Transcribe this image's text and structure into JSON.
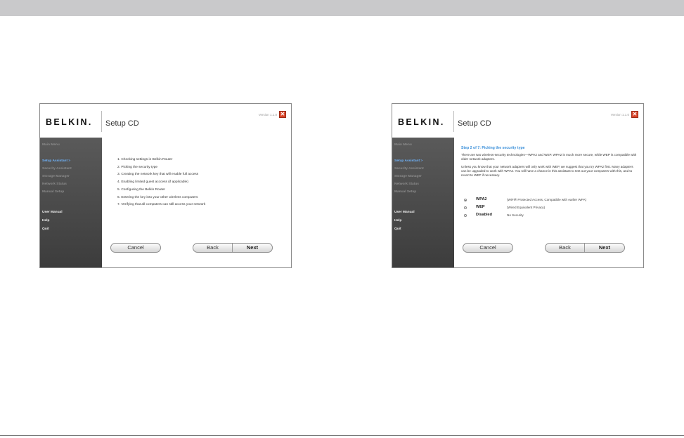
{
  "common": {
    "brand": "BELKIN.",
    "title": "Setup CD",
    "version": "Version 1.1.0",
    "close_symbol": "✕",
    "buttons": {
      "cancel": "Cancel",
      "back": "Back",
      "next": "Next"
    },
    "sidebar": {
      "main_menu": "Main Menu",
      "setup_assistant": "Setup Assistant  >",
      "security_assistant": "Security Assistant",
      "storage_manager": "Storage Manager",
      "network_status": "Network Status",
      "manual_setup": "Manual Setup",
      "user_manual": "User Manual",
      "help": "Help",
      "quit": "Quit"
    }
  },
  "left_window": {
    "steps": [
      "1. Checking settings in Belkin Router",
      "2. Picking the security type",
      "3. Creating the network key that will enable full access",
      "4. Enabling limited guest acccess (if applicable)",
      "5. Configuring the Belkin Router",
      "6. Entering the key into your other wireless computers",
      "7. Verifying that all computers can still access your network"
    ]
  },
  "right_window": {
    "step_heading": "Step 2 of 7: Picking the security type",
    "paragraph1": "There are two wireless-security technologies—WPA2 and WEP. WPA2 is much more secure, while WEP is compatible with older network adapters.",
    "paragraph2": "Unless you know that your network adapters will only work with WEP, we suggest that you try WPA2 first. Many adapters can be upgraded to work with WPA2. You will have a chance in this assistant to test out your computers with this, and to revert to WEP if necessary.",
    "options": [
      {
        "name": "WPA2",
        "desc": "(WiFi® Protected Access, Compatible with earlier WPA)",
        "selected": true
      },
      {
        "name": "WEP",
        "desc": "(Wired Equivalent Privacy)",
        "selected": false
      },
      {
        "name": "Disabled",
        "desc": "No Security",
        "selected": false
      }
    ]
  },
  "colors": {
    "accent_blue": "#3a8fd9",
    "sidebar_active": "#6fb5ff",
    "close_red": "#d9452a"
  }
}
